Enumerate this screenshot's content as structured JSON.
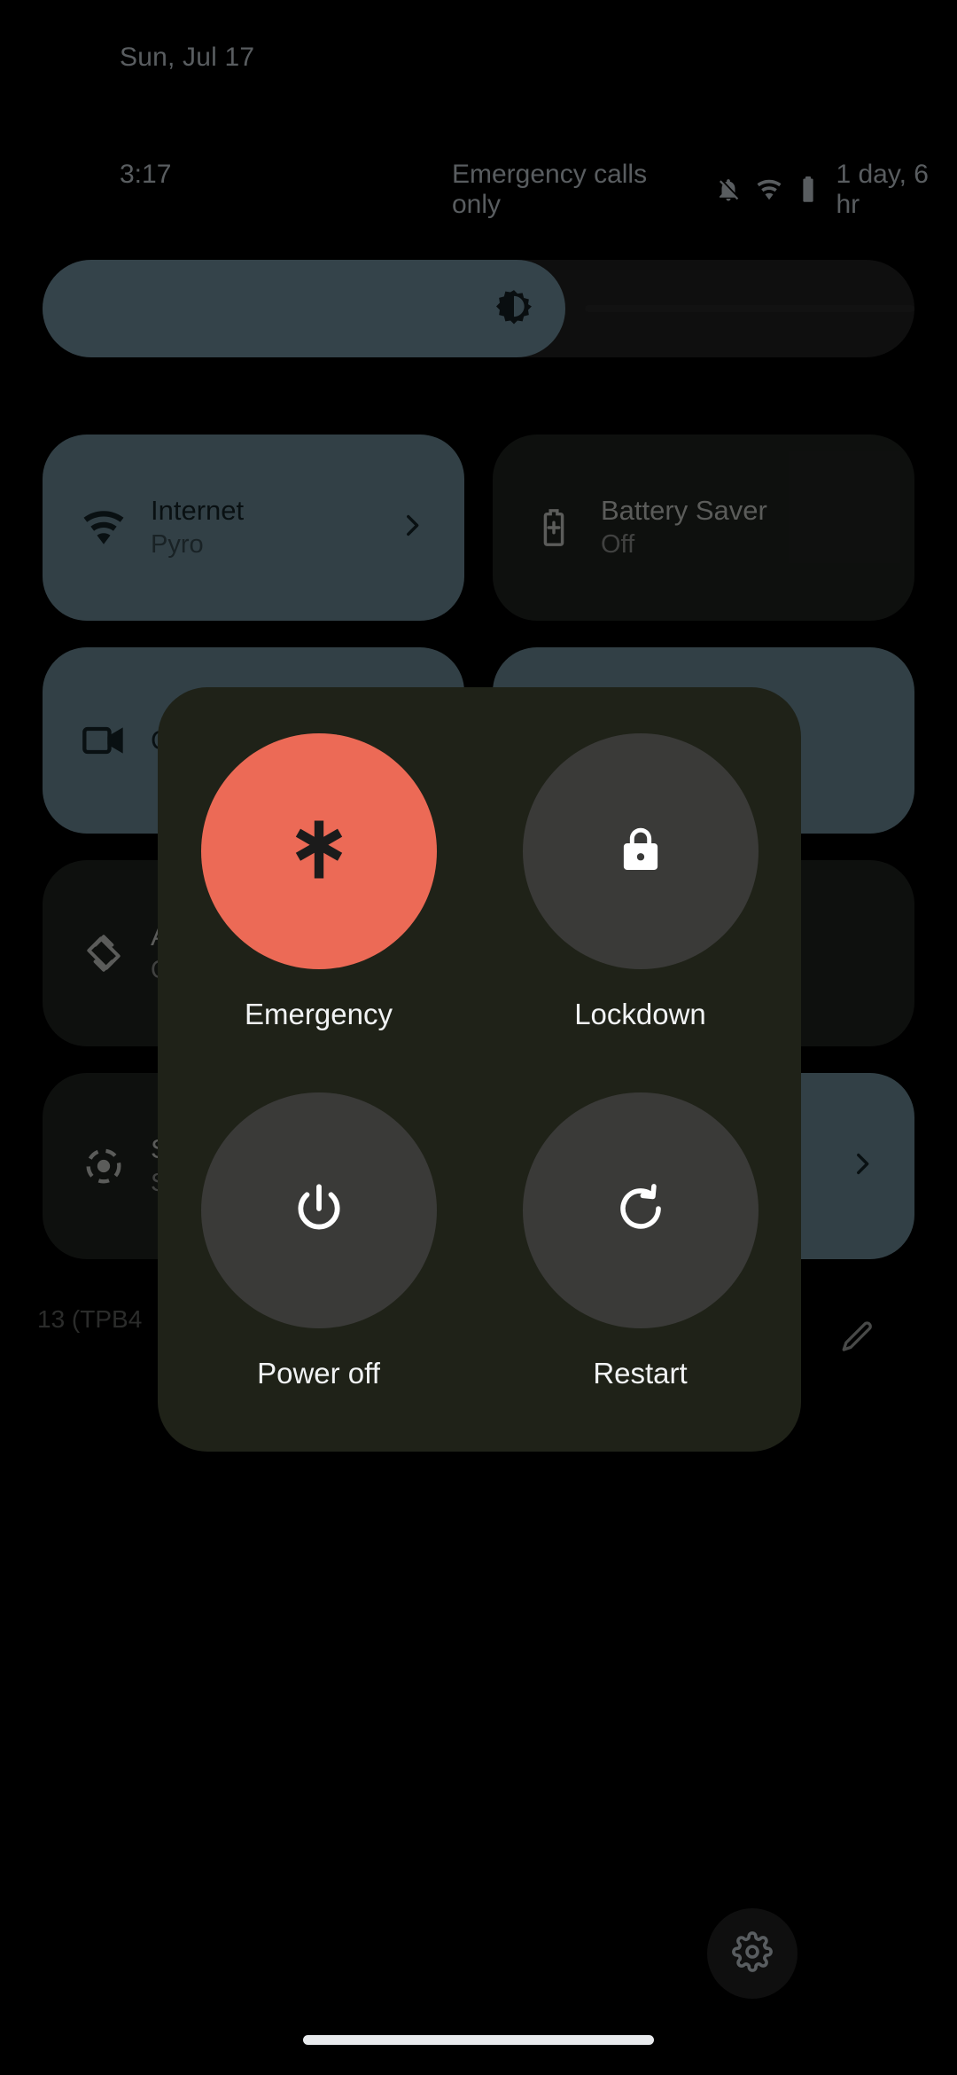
{
  "statusbar": {
    "date": "Sun, Jul 17",
    "clock": "3:17",
    "carrier": "Emergency calls only",
    "battery_text": "1 day, 6 hr",
    "icons": [
      "bell-off-icon",
      "wifi-icon",
      "battery-icon"
    ]
  },
  "brightness": {
    "label": "Brightness",
    "icon": "brightness-icon",
    "value_percent": 60
  },
  "tiles": [
    {
      "title": "Internet",
      "subtitle": "Pyro",
      "icon": "wifi-icon",
      "state": "active",
      "has_chevron": true
    },
    {
      "title": "Battery Saver",
      "subtitle": "Off",
      "icon": "battery-saver-icon",
      "state": "inactive",
      "has_chevron": false
    },
    {
      "title": "C",
      "subtitle": "",
      "icon": "screen-record-icon",
      "state": "active",
      "has_chevron": false
    },
    {
      "title": "",
      "subtitle": "",
      "icon": "blank-icon",
      "state": "active",
      "has_chevron": false
    },
    {
      "title": "A",
      "subtitle": "O",
      "icon": "auto-rotate-icon",
      "state": "inactive",
      "has_chevron": false
    },
    {
      "title": "",
      "subtitle": "",
      "icon": "blank-icon",
      "state": "inactive",
      "has_chevron": false
    },
    {
      "title": "S",
      "subtitle": "S",
      "icon": "location-icon",
      "state": "inactive",
      "has_chevron": false
    },
    {
      "title": "",
      "subtitle": "",
      "icon": "blank-icon",
      "state": "active",
      "has_chevron": true
    }
  ],
  "footer": {
    "build_text": "13 (TPB4",
    "edit_icon": "pencil-icon",
    "settings_icon": "gear-icon"
  },
  "power_dialog": {
    "items": [
      {
        "label": "Emergency",
        "icon": "emergency-star-icon",
        "style": "emergency"
      },
      {
        "label": "Lockdown",
        "icon": "lock-icon",
        "style": "neutral"
      },
      {
        "label": "Power off",
        "icon": "power-icon",
        "style": "neutral"
      },
      {
        "label": "Restart",
        "icon": "restart-icon",
        "style": "neutral"
      }
    ]
  },
  "colors": {
    "background": "#000000",
    "tile_active": "#566f79",
    "tile_inactive": "#191c19",
    "dialog_background": "#1f2218",
    "emergency": "#ec6a56",
    "neutral_circle": "#3a3a38",
    "text_primary": "#f1f3f4",
    "text_secondary": "#9aa0a6"
  }
}
